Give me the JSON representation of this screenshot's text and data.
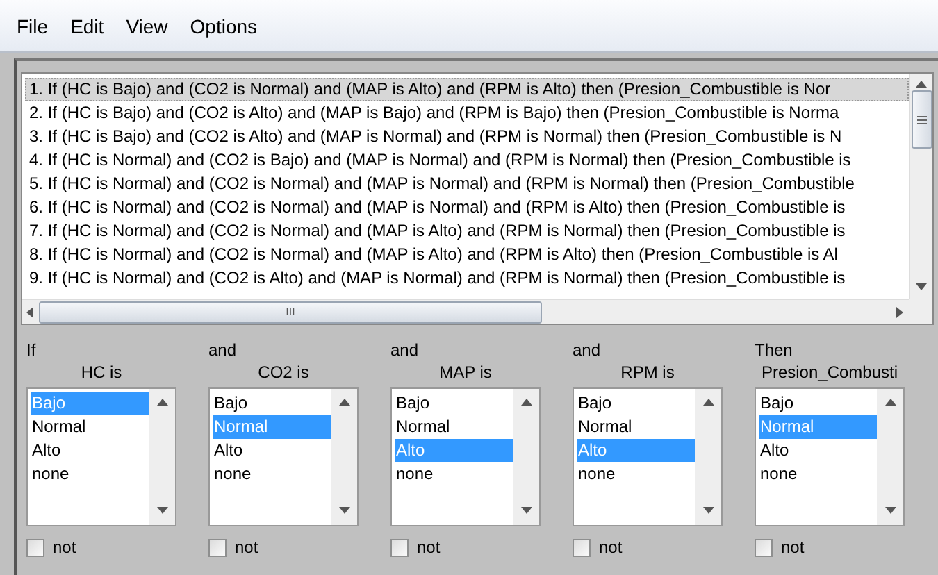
{
  "menu": [
    "File",
    "Edit",
    "View",
    "Options"
  ],
  "rules": [
    {
      "text": "1. If (HC is Bajo) and (CO2 is Normal) and (MAP is Alto) and (RPM is Alto) then (Presion_Combustible is Nor",
      "selected": true
    },
    {
      "text": "2. If (HC is Bajo) and (CO2 is Alto) and (MAP is Bajo) and (RPM is Bajo) then (Presion_Combustible is Norma",
      "selected": false
    },
    {
      "text": "3. If (HC is Bajo) and (CO2 is Alto) and (MAP is Normal) and (RPM is Normal) then (Presion_Combustible is N",
      "selected": false
    },
    {
      "text": "4. If (HC is Normal) and (CO2 is Bajo) and (MAP is Normal) and (RPM is Normal) then (Presion_Combustible is",
      "selected": false
    },
    {
      "text": "5. If (HC is Normal) and (CO2 is Normal) and (MAP is Normal) and (RPM is Normal) then (Presion_Combustible",
      "selected": false
    },
    {
      "text": "6. If (HC is Normal) and (CO2 is Normal) and (MAP is Normal) and (RPM is Alto) then (Presion_Combustible is",
      "selected": false
    },
    {
      "text": "7. If (HC is Normal) and (CO2 is Normal) and (MAP is Alto) and (RPM is Normal) then (Presion_Combustible is",
      "selected": false
    },
    {
      "text": "8. If (HC is Normal) and (CO2 is Normal) and (MAP is Alto) and (RPM is Alto) then (Presion_Combustible is Al",
      "selected": false
    },
    {
      "text": "9. If (HC is Normal) and (CO2 is Alto) and (MAP is Normal) and (RPM is Normal) then (Presion_Combustible is",
      "selected": false
    }
  ],
  "scroll_grip": "III",
  "columns": [
    {
      "connector": "If",
      "variable": "HC is",
      "not_label": "not",
      "not_checked": false,
      "options": [
        {
          "label": "Bajo",
          "selected": true
        },
        {
          "label": "Normal",
          "selected": false
        },
        {
          "label": "Alto",
          "selected": false
        },
        {
          "label": "none",
          "selected": false
        }
      ]
    },
    {
      "connector": "and",
      "variable": "CO2 is",
      "not_label": "not",
      "not_checked": false,
      "options": [
        {
          "label": "Bajo",
          "selected": false
        },
        {
          "label": "Normal",
          "selected": true
        },
        {
          "label": "Alto",
          "selected": false
        },
        {
          "label": "none",
          "selected": false
        }
      ]
    },
    {
      "connector": "and",
      "variable": "MAP is",
      "not_label": "not",
      "not_checked": false,
      "options": [
        {
          "label": "Bajo",
          "selected": false
        },
        {
          "label": "Normal",
          "selected": false
        },
        {
          "label": "Alto",
          "selected": true
        },
        {
          "label": "none",
          "selected": false
        }
      ]
    },
    {
      "connector": "and",
      "variable": "RPM is",
      "not_label": "not",
      "not_checked": false,
      "options": [
        {
          "label": "Bajo",
          "selected": false
        },
        {
          "label": "Normal",
          "selected": false
        },
        {
          "label": "Alto",
          "selected": true
        },
        {
          "label": "none",
          "selected": false
        }
      ]
    },
    {
      "connector": "Then",
      "variable": "Presion_Combusti",
      "not_label": "not",
      "not_checked": false,
      "options": [
        {
          "label": "Bajo",
          "selected": false
        },
        {
          "label": "Normal",
          "selected": true
        },
        {
          "label": "Alto",
          "selected": false
        },
        {
          "label": "none",
          "selected": false
        }
      ]
    }
  ]
}
